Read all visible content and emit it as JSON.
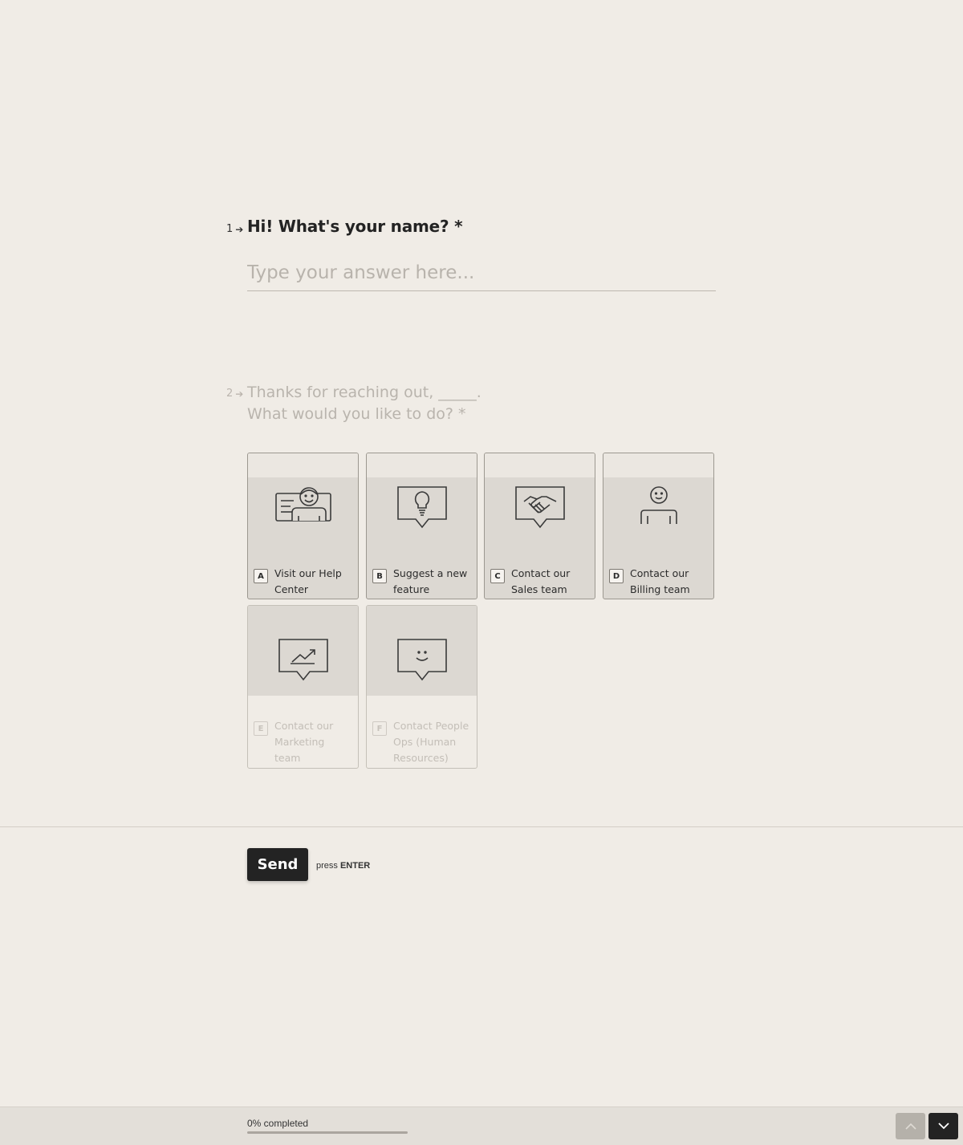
{
  "question1": {
    "number": "1",
    "title": "Hi! What's your name? *",
    "placeholder": "Type your answer here...",
    "value": ""
  },
  "question2": {
    "number": "2",
    "title_line1": "Thanks for reaching out, _____.",
    "title_line2": "What would you like to do? *",
    "choices": [
      {
        "key": "A",
        "label": "Visit our Help Center",
        "icon": "help-center-icon"
      },
      {
        "key": "B",
        "label": "Suggest a new feature",
        "icon": "lightbulb-speech-icon"
      },
      {
        "key": "C",
        "label": "Contact our Sales team",
        "icon": "handshake-speech-icon"
      },
      {
        "key": "D",
        "label": "Contact our Billing team",
        "icon": "person-desk-icon"
      },
      {
        "key": "E",
        "label": "Contact our Marketing team",
        "icon": "chart-speech-icon"
      },
      {
        "key": "F",
        "label": "Contact People Ops (Human Resources)",
        "icon": "smile-speech-icon"
      }
    ]
  },
  "submit": {
    "label": "Send",
    "hint_prefix": "press",
    "hint_key": "ENTER"
  },
  "footer": {
    "progress_text": "0% completed",
    "progress": 0,
    "up_icon": "chevron-up-icon",
    "down_icon": "chevron-down-icon"
  },
  "colors": {
    "background": "#f0ece6",
    "accent": "#232323",
    "choice_bg": "#dcd8d2"
  }
}
